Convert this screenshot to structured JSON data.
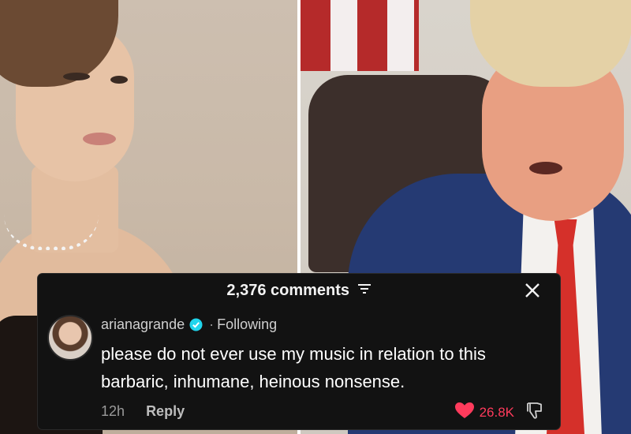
{
  "comments": {
    "count_label": "2,376 comments",
    "close_icon": "close-icon",
    "filter_icon": "filter-icon"
  },
  "comment": {
    "username": "arianagrande",
    "verified_icon": "verified-badge-icon",
    "separator": "·",
    "follow_status": "Following",
    "text": "please do not ever use my music in relation to this barbaric, inhumane, heinous nonsense.",
    "time": "12h",
    "reply_label": "Reply",
    "like_count": "26.8K",
    "like_icon": "heart-icon",
    "dislike_icon": "thumbs-down-icon"
  },
  "colors": {
    "card_bg": "#121212",
    "like": "#ff3b5c",
    "verified": "#20d5ec"
  }
}
